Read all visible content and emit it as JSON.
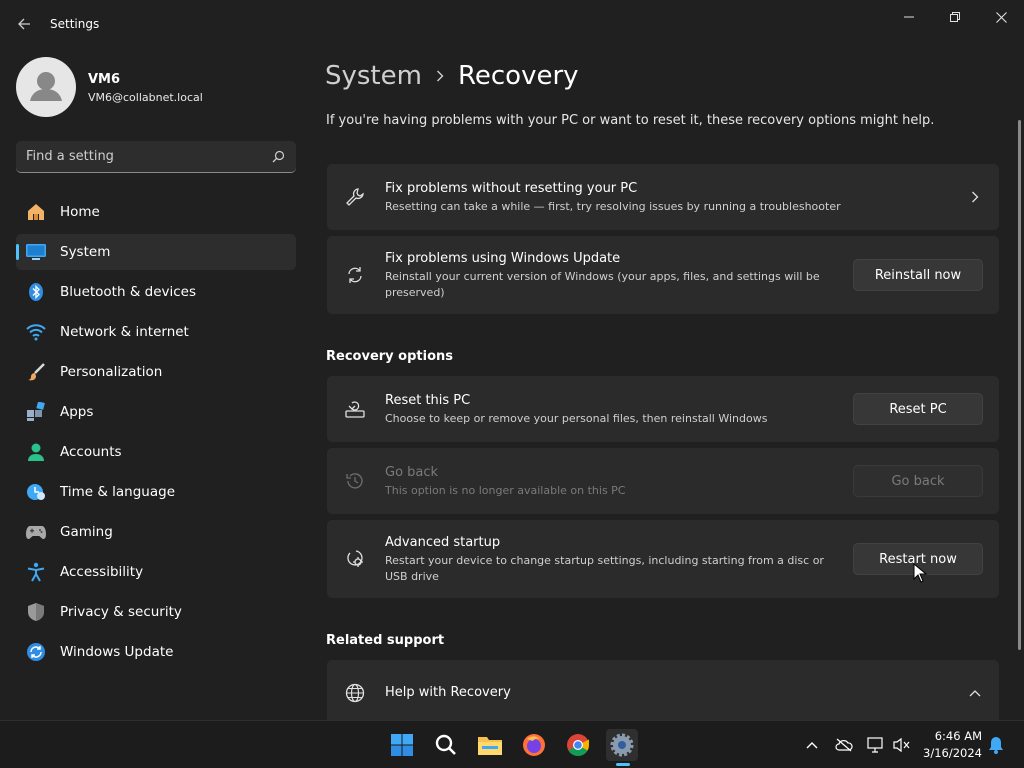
{
  "window": {
    "title": "Settings"
  },
  "profile": {
    "name": "VM6",
    "email": "VM6@collabnet.local"
  },
  "search": {
    "placeholder": "Find a setting"
  },
  "nav": {
    "items": [
      {
        "label": "Home",
        "icon": "home-icon"
      },
      {
        "label": "System",
        "icon": "system-icon",
        "active": true
      },
      {
        "label": "Bluetooth & devices",
        "icon": "bluetooth-icon"
      },
      {
        "label": "Network & internet",
        "icon": "wifi-icon"
      },
      {
        "label": "Personalization",
        "icon": "brush-icon"
      },
      {
        "label": "Apps",
        "icon": "apps-icon"
      },
      {
        "label": "Accounts",
        "icon": "accounts-icon"
      },
      {
        "label": "Time & language",
        "icon": "time-language-icon"
      },
      {
        "label": "Gaming",
        "icon": "gaming-icon"
      },
      {
        "label": "Accessibility",
        "icon": "accessibility-icon"
      },
      {
        "label": "Privacy & security",
        "icon": "shield-icon"
      },
      {
        "label": "Windows Update",
        "icon": "windows-update-icon"
      }
    ]
  },
  "breadcrumb": {
    "parent": "System",
    "current": "Recovery"
  },
  "intro": "If you're having problems with your PC or want to reset it, these recovery options might help.",
  "cards": {
    "fix_without_reset": {
      "title": "Fix problems without resetting your PC",
      "desc": "Resetting can take a while — first, try resolving issues by running a troubleshooter"
    },
    "fix_update": {
      "title": "Fix problems using Windows Update",
      "desc": "Reinstall your current version of Windows (your apps, files, and settings will be preserved)",
      "button": "Reinstall now"
    }
  },
  "recovery_options": {
    "title": "Recovery options",
    "reset": {
      "title": "Reset this PC",
      "desc": "Choose to keep or remove your personal files, then reinstall Windows",
      "button": "Reset PC"
    },
    "go_back": {
      "title": "Go back",
      "desc": "This option is no longer available on this PC",
      "button": "Go back"
    },
    "advanced": {
      "title": "Advanced startup",
      "desc": "Restart your device to change startup settings, including starting from a disc or USB drive",
      "button": "Restart now"
    }
  },
  "related_support": {
    "title": "Related support",
    "help": {
      "title": "Help with Recovery"
    }
  },
  "taskbar": {
    "time": "6:46 AM",
    "date": "3/16/2024",
    "apps": [
      "start-icon",
      "search-icon",
      "file-explorer-icon",
      "firefox-icon",
      "chrome-icon",
      "settings-icon"
    ]
  },
  "colors": {
    "accent": "#4cc2ff",
    "background": "#202020",
    "card": "#2b2b2b"
  }
}
